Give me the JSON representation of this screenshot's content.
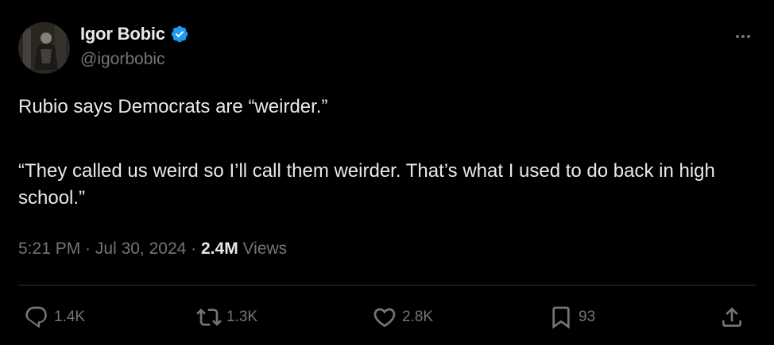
{
  "author": {
    "display_name": "Igor Bobic",
    "handle": "@igorbobic",
    "verified": true,
    "verified_color": "#1d9bf0"
  },
  "tweet": {
    "paragraph_1": "Rubio says Democrats are “weirder.”",
    "paragraph_2": "“They called us weird so I’ll call them weirder. That’s what I used to do back in high school.”"
  },
  "meta": {
    "time": "5:21 PM",
    "separator": " · ",
    "date": "Jul 30, 2024",
    "views_count": "2.4M",
    "views_label": "Views"
  },
  "actions": {
    "reply": {
      "icon": "reply-icon",
      "count": "1.4K"
    },
    "retweet": {
      "icon": "retweet-icon",
      "count": "1.3K"
    },
    "like": {
      "icon": "heart-icon",
      "count": "2.8K"
    },
    "bookmark": {
      "icon": "bookmark-icon",
      "count": "93"
    },
    "share": {
      "icon": "share-icon"
    }
  },
  "colors": {
    "background": "#000000",
    "primary_text": "#e7e9ea",
    "secondary_text": "#71767b",
    "divider": "#2f3336"
  }
}
